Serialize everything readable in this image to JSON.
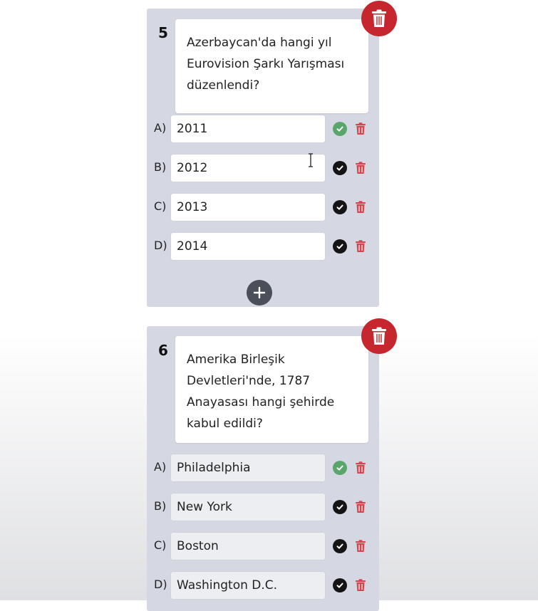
{
  "questions": [
    {
      "number": "5",
      "text": "Azerbaycan'da hangi yıl Eurovision Şarkı Yarışması düzenlendi?",
      "options": [
        {
          "label": "A)",
          "value": "2011",
          "correct": true
        },
        {
          "label": "B)",
          "value": "2012",
          "correct": false
        },
        {
          "label": "C)",
          "value": "2013",
          "correct": false
        },
        {
          "label": "D)",
          "value": "2014",
          "correct": false
        }
      ]
    },
    {
      "number": "6",
      "text": "Amerika Birleşik Devletleri'nde, 1787 Anayasası hangi şehirde kabul edildi?",
      "options": [
        {
          "label": "A)",
          "value": "Philadelphia",
          "correct": true
        },
        {
          "label": "B)",
          "value": "New York",
          "correct": false
        },
        {
          "label": "C)",
          "value": "Boston",
          "correct": false
        },
        {
          "label": "D)",
          "value": "Washington D.C.",
          "correct": false
        }
      ]
    }
  ],
  "colors": {
    "delete_red": "#c6262e",
    "correct_green": "#58a66a",
    "card_bg": "#d5d8e3"
  },
  "icons": {
    "delete_question": "trash-icon",
    "delete_option": "trash-icon",
    "correct_mark": "check-circle-icon",
    "add_option": "plus-icon",
    "cursor": "text-cursor-icon"
  }
}
